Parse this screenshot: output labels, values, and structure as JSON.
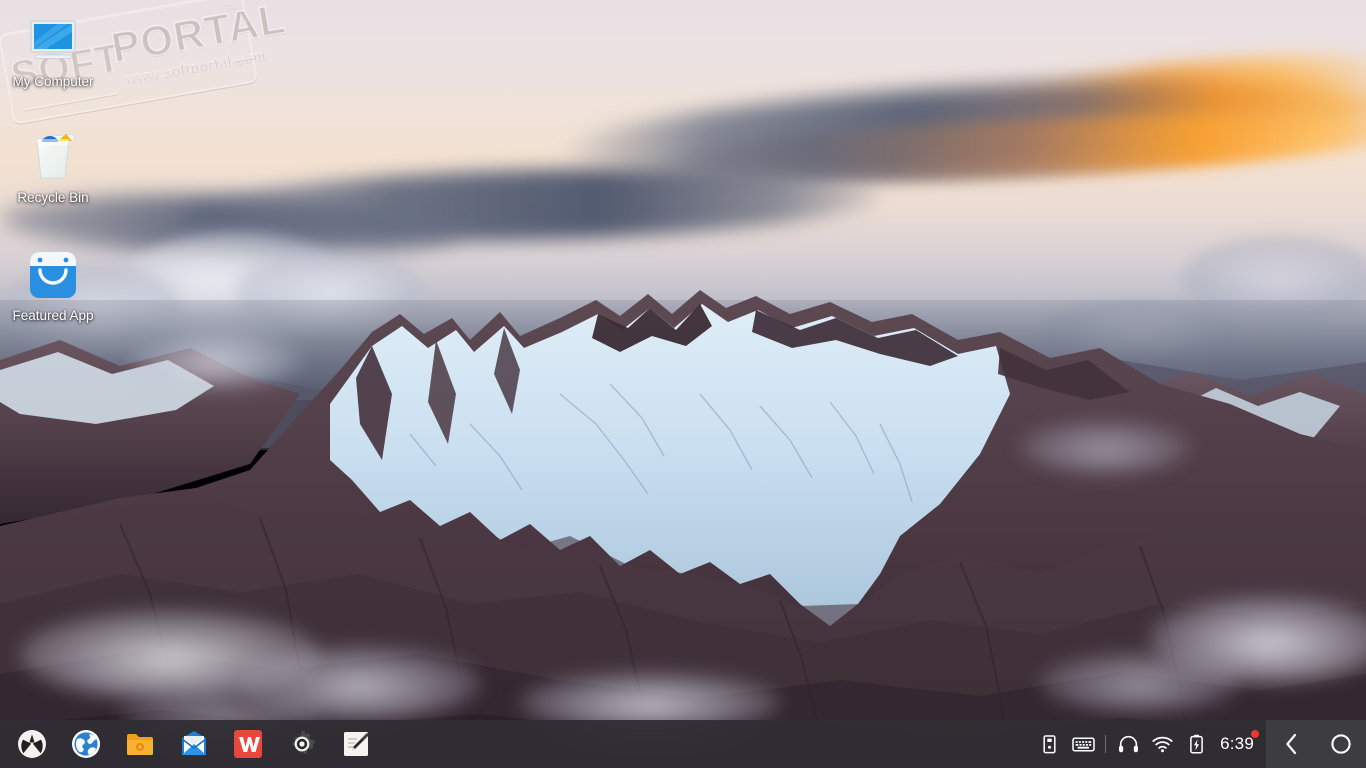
{
  "desktop": {
    "wallpaper_description": "Snow-capped mountain range at sunset with orange-lit clouds",
    "icons": [
      {
        "label": "My Computer",
        "icon": "monitor-icon"
      },
      {
        "label": "Recycle Bin",
        "icon": "trash-bin-icon"
      },
      {
        "label": "Featured App",
        "icon": "app-store-bag-icon"
      }
    ]
  },
  "watermark": {
    "word1": "SOFT",
    "word2": "PORTAL",
    "trademark": "TM",
    "url": "www.softportal.com"
  },
  "taskbar": {
    "apps": [
      {
        "name": "launcher",
        "label": "Launcher",
        "icon": "deepin-launcher-icon"
      },
      {
        "name": "browser",
        "label": "Browser",
        "icon": "globe-browser-icon"
      },
      {
        "name": "file-manager",
        "label": "File Manager",
        "icon": "folder-icon"
      },
      {
        "name": "mail",
        "label": "Mail",
        "icon": "envelope-icon"
      },
      {
        "name": "wps-office",
        "label": "WPS Office",
        "icon": "wps-w-icon"
      },
      {
        "name": "settings",
        "label": "Control Center",
        "icon": "gear-icon"
      },
      {
        "name": "text-editor",
        "label": "Text Editor",
        "icon": "pen-note-icon"
      }
    ],
    "tray": [
      {
        "name": "usb-device",
        "label": "USB Device",
        "icon": "usb-drive-icon"
      },
      {
        "name": "input-method",
        "label": "Input Method",
        "icon": "keyboard-icon"
      },
      {
        "name": "sound",
        "label": "Sound",
        "icon": "headphones-icon"
      },
      {
        "name": "network",
        "label": "Network",
        "icon": "wifi-icon"
      },
      {
        "name": "battery",
        "label": "Battery",
        "icon": "battery-charging-icon"
      }
    ],
    "clock": "6:39",
    "has_notification": true,
    "corner": [
      {
        "name": "notification-center",
        "label": "Notification Center",
        "icon": "chevron-left-icon"
      },
      {
        "name": "show-desktop",
        "label": "Show Desktop",
        "icon": "circle-icon"
      }
    ]
  },
  "colors": {
    "taskbar_bg": "#302f34",
    "corner_bg": "#3e3d42",
    "notification_dot": "#f0362c",
    "accent_blue": "#2a8fe0",
    "wps_red": "#e8483c",
    "folder_orange": "#f5a118",
    "sky_top": "#e9e0e5",
    "sky_warm": "#f3e1d1",
    "cloud_orange": "#f5a032",
    "rock_purple": "#4a3a42",
    "snow_blue": "#cfe2ee"
  }
}
